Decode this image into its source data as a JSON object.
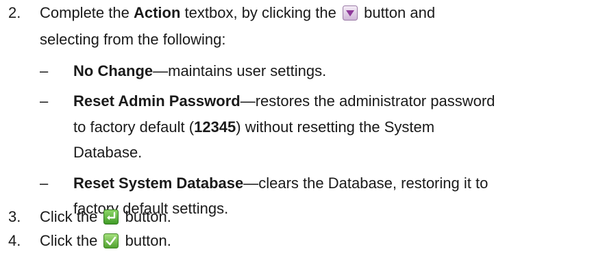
{
  "steps": [
    {
      "number": "2.",
      "text_a": "Complete the ",
      "bold": "Action",
      "text_b": " textbox, by clicking the ",
      "icon": "dropdown-arrow-icon",
      "text_c": " button and",
      "text_d": "selecting from the following:"
    },
    {
      "number": "3.",
      "text_a": "Click the ",
      "icon": "enter-return-icon",
      "text_b": " button."
    },
    {
      "number": "4.",
      "text_a": "Click the ",
      "icon": "checkmark-icon",
      "text_b": " button."
    }
  ],
  "options": [
    {
      "bullet": "–",
      "term": "No Change",
      "desc": "—maintains user settings."
    },
    {
      "bullet": "–",
      "term": "Reset Admin Password",
      "desc_1": "—restores the administrator password",
      "desc_2": "to factory default (",
      "code": "12345",
      "desc_3": ") without resetting the System",
      "desc_4": "Database."
    },
    {
      "bullet": "–",
      "term": "Reset System Database",
      "desc_1": "—clears the Database, restoring it to",
      "desc_2": "factory default settings."
    }
  ],
  "colors": {
    "dropdown_icon": "#8e3a9a",
    "enter_icon": "#4caf35",
    "check_icon": "#5fb838"
  }
}
